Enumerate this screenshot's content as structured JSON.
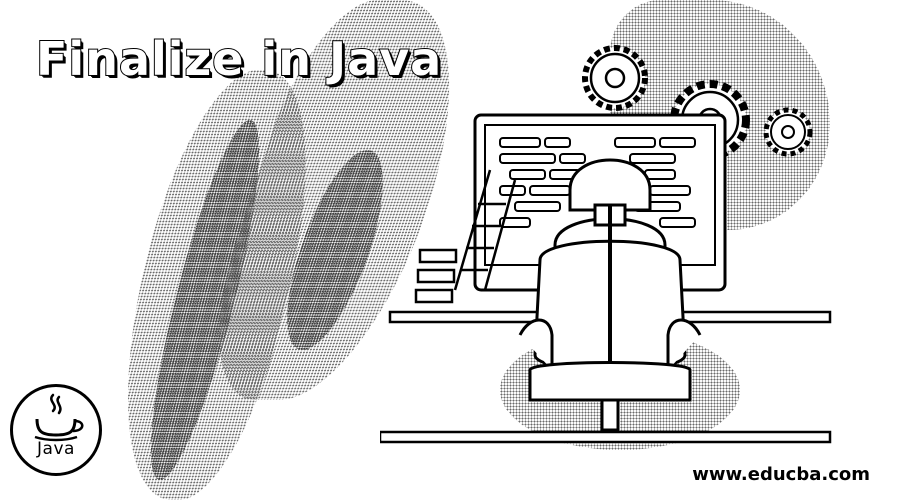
{
  "banner": {
    "title": "Finalize in Java",
    "badge_text": "Java",
    "website": "www.educba.com"
  },
  "icons": {
    "badge": "java-coffee-cup-icon",
    "gears": "gear-icon",
    "illustration": "developer-at-computer-illustration"
  },
  "colors": {
    "background": "#ffffff",
    "ink": "#000000",
    "texture": "#6a6a6a"
  }
}
